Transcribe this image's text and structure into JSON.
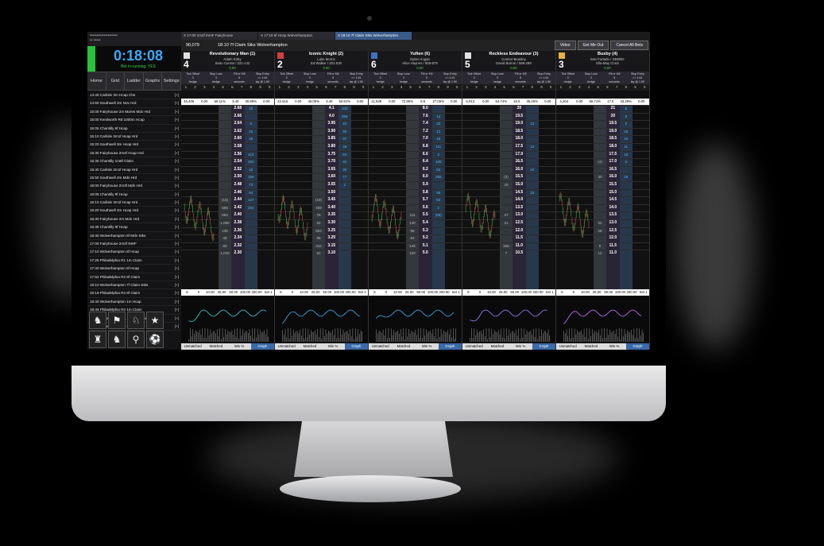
{
  "app": {
    "sidebar_top_label": "••••••••••••••••••••",
    "sidebar_top_sub": "•• •••••",
    "timer": "0:18:08",
    "bet_in_running": "Bet in-running: YES",
    "nav": [
      "Home",
      "Grid",
      "Ladder",
      "Graphs",
      "Settings"
    ]
  },
  "races": [
    {
      "name": "14:40 Carlisle 3m Hcap Chs",
      "tag": "[+]"
    },
    {
      "name": "14:50 Southwell 2m Nov Hrd",
      "tag": "[+]"
    },
    {
      "name": "15:00 Fairyhouse 2m Mares Mdn Hrd",
      "tag": "[+]"
    },
    {
      "name": "15:00 Kenilworth R8 1000m Hcap",
      "tag": "[+]"
    },
    {
      "name": "15:05 Chantilly 6f Hcap",
      "tag": "[+]"
    },
    {
      "name": "15:10 Carlisle 2m1f Hcap Hrd",
      "tag": "[+]"
    },
    {
      "name": "15:20 Southwell 3m Hcap Hrd",
      "tag": "[+]"
    },
    {
      "name": "15:30 Fairyhouse 2m4f Hcap Hrd",
      "tag": "[+]"
    },
    {
      "name": "15:35 Chantilly 1m6f Claim",
      "tag": "[+]"
    },
    {
      "name": "15:40 Carlisle 2m1f Hcap Hrd",
      "tag": "[+]"
    },
    {
      "name": "15:50 Southwell 2m Mdn Hrd",
      "tag": "[+]"
    },
    {
      "name": "16:00 Fairyhouse 2m3f Mdn Hrd",
      "tag": "[+]"
    },
    {
      "name": "16:05 Chantilly 8f Hcap",
      "tag": "[+]"
    },
    {
      "name": "16:10 Carlisle 3m1f Hcap Hrd",
      "tag": "[+]"
    },
    {
      "name": "16:20 Southwell 2m Hcap Hrd",
      "tag": "[+]"
    },
    {
      "name": "16:30 Fairyhouse 2m Mdn Hrd",
      "tag": "[+]"
    },
    {
      "name": "16:35 Chantilly 8f Hcap",
      "tag": "[+]"
    },
    {
      "name": "16:40 Wolverhampton 6f Mdn Stks",
      "tag": "[+]"
    },
    {
      "name": "17:00 Fairyhouse 2m2f INHF",
      "tag": "[+]"
    },
    {
      "name": "17:10 Wolverhampton 6f Hcap",
      "tag": "[+]"
    },
    {
      "name": "17:25 Philadelphia R1 1m Claim",
      "tag": "[+]"
    },
    {
      "name": "17:40 Wolverhampton 6f Hcap",
      "tag": "[+]"
    },
    {
      "name": "17:52 Philadelphia R2 6f Claim",
      "tag": "[+]"
    },
    {
      "name": "18:10 Wolverhampton 7f Claim Stks",
      "tag": "[+]"
    },
    {
      "name": "18:19 Philadelphia R3 6f Claim",
      "tag": "[+]"
    },
    {
      "name": "18:40 Wolverhampton 1m Hcap",
      "tag": "[+]"
    },
    {
      "name": "18:46 Philadelphia R4 1m Claim",
      "tag": "[+]"
    },
    {
      "name": "18:55 Delta Downs R1 7f Mdn Claim",
      "tag": "[+]"
    },
    {
      "name": "19:10 Wolverhampton 1m1f Hcap",
      "tag": "[+]"
    }
  ],
  "tabs": [
    {
      "label": "X  17:00 2m2f INHF Fairyhouse",
      "active": false
    },
    {
      "label": "X  17:10 6f Hcap Wolverhampton",
      "active": false
    },
    {
      "label": "X  18:10 7f Claim Stks Wolverhampton",
      "active": true
    }
  ],
  "header": {
    "id": "90,079",
    "race_title": "18:10 7f Claim Stks Wolverhampton",
    "video": "Video",
    "get_me_out": "Get Me Out",
    "cancel_all": "Cancel All Bets"
  },
  "runners": [
    {
      "num": "4",
      "name": "Revolutionary Man (1)",
      "jockey": "Adam Kirby",
      "trainer": "Sean Curran / 221-142",
      "pnl": "0.00",
      "silk": "#e0e0e0",
      "opts": [
        "Tick Offset\n3\nhedge",
        "Stop Loss\n3\nhedge",
        "Fill or Kill\n5\nseconds",
        "Stop Entry\n>= 1.61\nlay @ 1.50"
      ],
      "summary": [
        "46,406",
        "0.00",
        "69.11%",
        "3.40",
        "30.89%",
        "0.00"
      ],
      "prices": [
        "2.68",
        "2.66",
        "2.64",
        "2.62",
        "2.60",
        "2.58",
        "2.56",
        "2.54",
        "2.52",
        "2.50",
        "2.48",
        "2.46",
        "2.44",
        "2.42",
        "2.40",
        "2.38",
        "2.36",
        "2.34",
        "2.32",
        "2.30"
      ],
      "lay": [
        "18",
        "",
        "5",
        "15",
        "25",
        "",
        "113",
        "162",
        "22",
        "156",
        "73",
        "64",
        "127",
        "254",
        "",
        "",
        "",
        "",
        "",
        ""
      ],
      "vol": [
        "",
        "",
        "",
        "",
        "",
        "",
        "",
        "",
        "",
        "",
        "",
        "",
        "(16)",
        "656",
        "563",
        "1,080",
        "139",
        "48",
        "83",
        "1,018"
      ]
    },
    {
      "num": "2",
      "name": "Iconic Knight (2)",
      "jockey": "Luke Morris",
      "trainer": "Ed Walker / 201-530",
      "pnl": "0.00",
      "silk": "#d04040",
      "opts": [
        "Tick Offset\n3\nhedge",
        "Stop Loss\n3\nhedge",
        "Fill or Kill\n5\nseconds",
        "Stop Entry\n>= 1.61\nlay @ 1.50"
      ],
      "summary": [
        "22,515",
        "0.00",
        "46.09%",
        "3.40",
        "53.91%",
        "0.00"
      ],
      "prices": [
        "4.1",
        "4.0",
        "3.95",
        "3.90",
        "3.85",
        "3.80",
        "3.75",
        "3.70",
        "3.65",
        "3.60",
        "3.55",
        "3.50",
        "3.45",
        "3.40",
        "3.35",
        "3.30",
        "3.25",
        "3.20",
        "3.15",
        "3.10"
      ],
      "lay": [
        "100",
        "256",
        "22",
        "95",
        "97",
        "48",
        "60",
        "32",
        "36",
        "77",
        "2",
        "",
        "",
        "",
        "",
        "",
        "",
        "",
        "",
        ""
      ],
      "vol": [
        "",
        "",
        "",
        "",
        "",
        "",
        "",
        "",
        "",
        "",
        "",
        "",
        "(19)",
        "408",
        "76",
        "52",
        "663",
        "85",
        "316",
        "22"
      ]
    },
    {
      "num": "6",
      "name": "Yuften (6)",
      "jockey": "Dylan Hogan",
      "trainer": "Alice Haynes / 855-879",
      "pnl": "0.00",
      "silk": "#4070c0",
      "opts": [
        "Tick Offset\n3\nhedge",
        "Stop Loss\n3\nhedge",
        "Fill or Kill\n5\nseconds",
        "Stop Entry\n>= 1.61\nlay @ 1.50"
      ],
      "summary": [
        "11,939",
        "0.00",
        "72.95%",
        "5.5",
        "27.05%",
        "0.00"
      ],
      "prices": [
        "8.0",
        "7.6",
        "7.4",
        "7.2",
        "7.0",
        "6.8",
        "6.6",
        "6.4",
        "6.2",
        "6.0",
        "5.9",
        "5.8",
        "5.7",
        "5.6",
        "5.5",
        "5.4",
        "5.3",
        "5.2",
        "5.1",
        "5.0"
      ],
      "lay": [
        "",
        "12",
        "42",
        "12",
        "19",
        "111",
        "2",
        "105",
        "52",
        "266",
        "",
        "95",
        "53",
        "2",
        "(69)",
        "",
        "",
        "",
        "",
        ""
      ],
      "vol": [
        "",
        "",
        "",
        "",
        "",
        "",
        "",
        "",
        "",
        "",
        "",
        "",
        "",
        "",
        "111",
        "140",
        "58",
        "63",
        "145",
        "120"
      ]
    },
    {
      "num": "5",
      "name": "Reckless Endeavour (3)",
      "jockey": "Connor Beasley",
      "trainer": "David Barron / 586-298",
      "pnl": "0.00",
      "silk": "#e0e0e0",
      "opts": [
        "Tick Offset\n3\nhedge",
        "Stop Loss\n3\nhedge",
        "Fill or Kill\n5\nseconds",
        "Stop Entry\n>= 1.61\nlay @ 1.50"
      ],
      "summary": [
        "5,013",
        "0.00",
        "64.74%",
        "15.5",
        "35.26%",
        "0.00"
      ],
      "prices": [
        "20",
        "19.5",
        "19.0",
        "18.5",
        "18.0",
        "17.5",
        "17.0",
        "16.5",
        "16.0",
        "15.5",
        "15.0",
        "14.5",
        "14.0",
        "13.5",
        "13.0",
        "12.5",
        "12.0",
        "11.5",
        "11.0",
        "10.5"
      ],
      "lay": [
        "",
        "",
        "13",
        "",
        "",
        "12",
        "",
        "",
        "20",
        "",
        "",
        "15",
        "",
        "",
        "",
        "",
        "",
        "",
        "",
        ""
      ],
      "vol": [
        "",
        "",
        "",
        "",
        "",
        "",
        "",
        "",
        "",
        "(3)",
        "20",
        "",
        "",
        "",
        "27",
        "21",
        "",
        "",
        "106",
        "7"
      ]
    },
    {
      "num": "3",
      "name": "Busby (4)",
      "jockey": "Ivan Furtado / 338000-",
      "trainer": "Ella-May Croot",
      "pnl": "0.00",
      "silk": "#e8b040",
      "opts": [
        "Tick Offset\n3\nhedge",
        "Stop Loss\n3\nhedge",
        "Fill or Kill\n5\nseconds",
        "Stop Entry\n>= 1.61\nlay @ 1.50"
      ],
      "summary": [
        "4,204",
        "0.00",
        "56.71%",
        "17.0",
        "43.29%",
        "0.00"
      ],
      "prices": [
        "21",
        "20",
        "19.5",
        "19.0",
        "18.5",
        "18.0",
        "17.5",
        "17.0",
        "16.5",
        "16.0",
        "15.5",
        "15.0",
        "14.5",
        "14.0",
        "13.5",
        "13.0",
        "12.5",
        "12.0",
        "11.5",
        "11.0"
      ],
      "lay": [
        "5",
        "3",
        "2",
        "25",
        "15",
        "11",
        "18",
        "3",
        "",
        "16",
        "",
        "",
        "",
        "",
        "",
        "",
        "",
        "",
        "",
        ""
      ],
      "vol": [
        "",
        "",
        "",
        "",
        "",
        "",
        "",
        "(4)",
        "",
        "30",
        "",
        "",
        "",
        "",
        "",
        "22",
        "28",
        "",
        "5",
        "12"
      ]
    }
  ],
  "tick_numbers": [
    "1",
    "2",
    "3",
    "4",
    "5",
    "6",
    "7",
    "8",
    "9",
    "0"
  ],
  "graph_bar": [
    "S",
    "0",
    "10.00",
    "25.00",
    "50.00",
    "100.00",
    "200.00",
    "Set 1"
  ],
  "bottom_tabs": [
    "Unmatched",
    "Matched",
    "Win %",
    "Graph"
  ],
  "sidebar_icons": [
    "horse-race-icon",
    "racing-icon",
    "greyhound-icon",
    "runner-icon",
    "jockey-icon",
    "horse-icon",
    "trot-icon",
    "soccer-icon",
    "target-icon",
    "list-icon"
  ],
  "colors": {
    "timer": "#3aaaff",
    "accent_green": "#29c23a",
    "active_tab": "#3a5a8a"
  }
}
